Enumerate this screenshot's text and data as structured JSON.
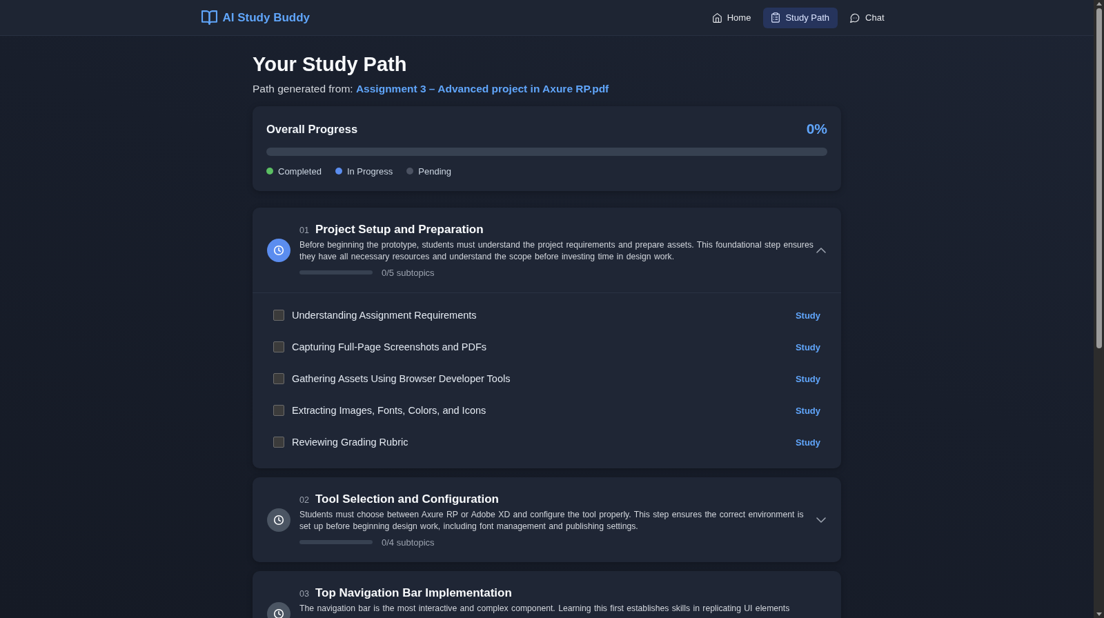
{
  "header": {
    "logo": "AI Study Buddy",
    "nav": [
      {
        "kind": "home",
        "label": "Home",
        "selected": false
      },
      {
        "kind": "path",
        "label": "Study Path",
        "selected": true
      },
      {
        "kind": "chat",
        "label": "Chat",
        "selected": false
      }
    ]
  },
  "page": {
    "title": "Your Study Path",
    "source_label": "Path generated from:",
    "source_file": "Assignment 3 – Advanced project in Axure RP.pdf"
  },
  "overall_progress": {
    "title": "Overall Progress",
    "percent": "0%",
    "level": 0,
    "legend": [
      {
        "label": "Completed",
        "color": "#5bbf63"
      },
      {
        "label": "In Progress",
        "color": "#5b8def"
      },
      {
        "label": "Pending",
        "color": "#4b5262"
      }
    ]
  },
  "steps": [
    {
      "number": "01",
      "title": "Project Setup and Preparation",
      "description": "Before beginning the prototype, students must understand the project requirements and prepare assets. This foundational step ensures they have all necessary resources and understand the scope before investing time in design work.",
      "color": "#5b8def",
      "expanded": true,
      "level": 0,
      "count": "0/5 subtopics",
      "subtopics": [
        {
          "title": "Understanding Assignment Requirements",
          "checked": false,
          "action": "Study"
        },
        {
          "title": "Capturing Full-Page Screenshots and PDFs",
          "checked": false,
          "action": "Study"
        },
        {
          "title": "Gathering Assets Using Browser Developer Tools",
          "checked": false,
          "action": "Study"
        },
        {
          "title": "Extracting Images, Fonts, Colors, and Icons",
          "checked": false,
          "action": "Study"
        },
        {
          "title": "Reviewing Grading Rubric",
          "checked": false,
          "action": "Study"
        }
      ]
    },
    {
      "number": "02",
      "title": "Tool Selection and Configuration",
      "description": "Students must choose between Axure RP or Adobe XD and configure the tool properly. This step ensures the correct environment is set up before beginning design work, including font management and publishing settings.",
      "color": "#4b5563",
      "expanded": false,
      "level": 0,
      "count": "0/4 subtopics"
    },
    {
      "number": "03",
      "title": "Top Navigation Bar Implementation",
      "description": "The navigation bar is the most interactive and complex component. Learning this first establishes skills in replicating UI elements",
      "color": "#4b5563"
    }
  ]
}
